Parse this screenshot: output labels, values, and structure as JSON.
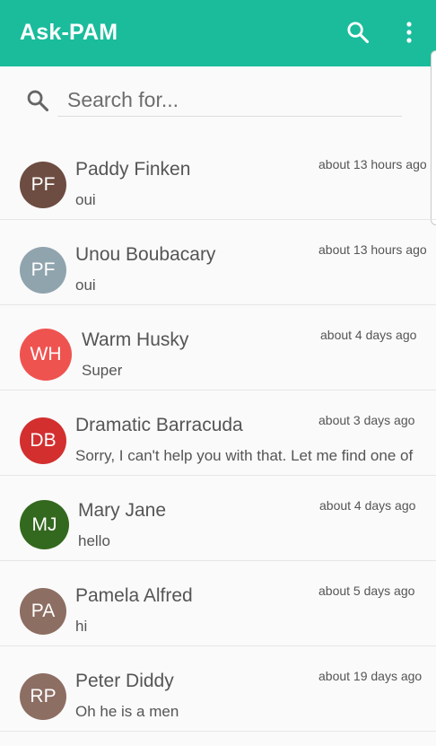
{
  "appbar": {
    "title": "Ask-PAM",
    "color": "#1abc9c"
  },
  "search": {
    "placeholder": "Search for..."
  },
  "conversations": [
    {
      "initials": "PF",
      "name": "Paddy Finken",
      "message": "oui",
      "time": "about 13 hours ago",
      "avatar_color": "#6d4c41"
    },
    {
      "initials": "PF",
      "name": "Unou Boubacary",
      "message": "oui",
      "time": "about 13 hours ago",
      "avatar_color": "#90a4ae"
    },
    {
      "initials": "WH",
      "name": "Warm Husky",
      "message": "Super",
      "time": "about 4 days ago",
      "avatar_color": "#ef5350"
    },
    {
      "initials": "DB",
      "name": "Dramatic Barracuda",
      "message": "Sorry, I can't help you with that. Let me find one of",
      "time": "about 3 days ago",
      "avatar_color": "#d32f2f"
    },
    {
      "initials": "MJ",
      "name": "Mary Jane",
      "message": "hello",
      "time": "about 4 days ago",
      "avatar_color": "#33691e"
    },
    {
      "initials": "PA",
      "name": "Pamela Alfred",
      "message": "hi",
      "time": "about 5 days ago",
      "avatar_color": "#8d6e63"
    },
    {
      "initials": "RP",
      "name": "Peter Diddy",
      "message": "Oh he is a men",
      "time": "about 19 days ago",
      "avatar_color": "#8d6e63"
    }
  ]
}
